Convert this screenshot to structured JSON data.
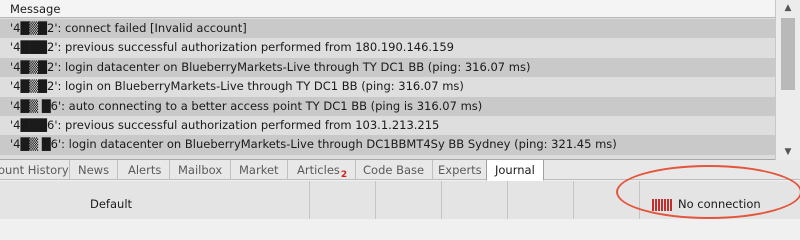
{
  "journal": {
    "column_header": "Message",
    "rows": [
      "'4█▒█2': connect failed [Invalid account]",
      "'4███2': previous successful authorization performed from 180.190.146.159",
      "'4█▒█2': login datacenter on BlueberryMarkets-Live through TY DC1 BB (ping: 316.07 ms)",
      "'4█▒█2': login on BlueberryMarkets-Live through TY DC1 BB (ping: 316.07 ms)",
      "'4█▒ █6': auto connecting to a better access point TY DC1 BB (ping is 316.07 ms)",
      "'4███6': previous successful authorization performed from 103.1.213.215",
      "'4█▒ █6': login datacenter on BlueberryMarkets-Live through DC1BBMT4Sy  BB Sydney (ping: 321.45 ms)"
    ]
  },
  "tabs": [
    {
      "label": "ount History"
    },
    {
      "label": "News"
    },
    {
      "label": "Alerts"
    },
    {
      "label": "Mailbox"
    },
    {
      "label": "Market"
    },
    {
      "label": "Articles",
      "badge": "2"
    },
    {
      "label": "Code Base"
    },
    {
      "label": "Experts"
    },
    {
      "label": "Journal"
    }
  ],
  "status": {
    "profile": "Default",
    "connection": "No connection"
  },
  "colors": {
    "highlight": "#e4553c",
    "badge": "#d02020"
  }
}
